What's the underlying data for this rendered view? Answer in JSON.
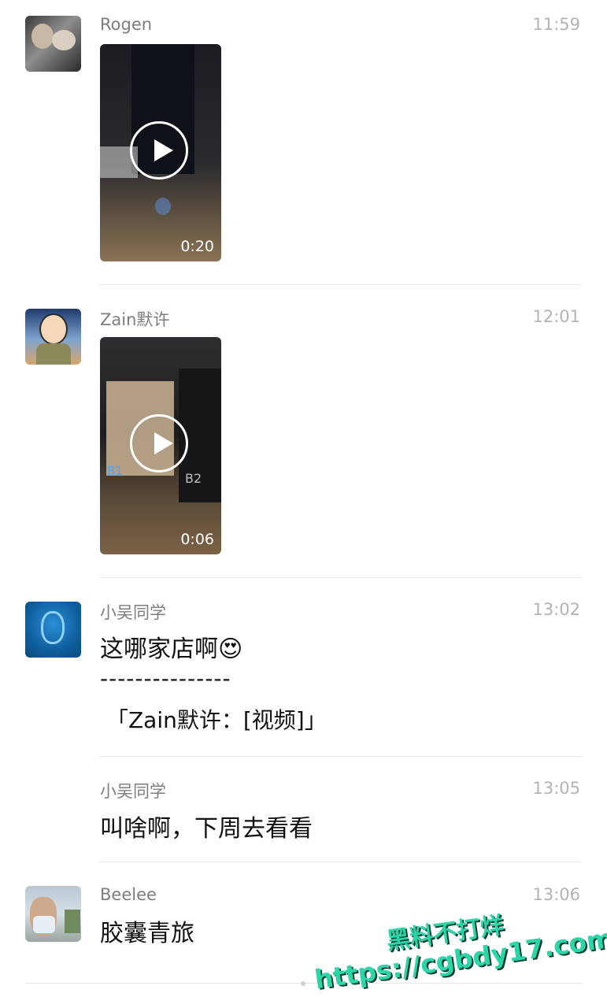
{
  "messages": [
    {
      "name": "Rogen",
      "time": "11:59",
      "video_duration": "0:20"
    },
    {
      "name": "Zain默许",
      "time": "12:01",
      "video_duration": "0:06",
      "video_labels": [
        "B1",
        "B2"
      ]
    },
    {
      "name": "小吴同学",
      "time": "13:02",
      "text": "这哪家店啊😍",
      "separator": "---------------",
      "quote": "「Zain默许：[视频]」"
    },
    {
      "name": "小吴同学",
      "time": "13:05",
      "text": "叫啥啊，下周去看看"
    },
    {
      "name": "Beelee",
      "time": "13:06",
      "text": "胶囊青旅"
    }
  ],
  "watermark": {
    "line1": "黑料不打烊",
    "line2": "https://cgbdy17.com"
  },
  "colors": {
    "name": "#7d7d7d",
    "time": "#b3b3b3",
    "text": "#111111",
    "divider": "#e6e6e6",
    "watermark": "#2ad6a8"
  }
}
